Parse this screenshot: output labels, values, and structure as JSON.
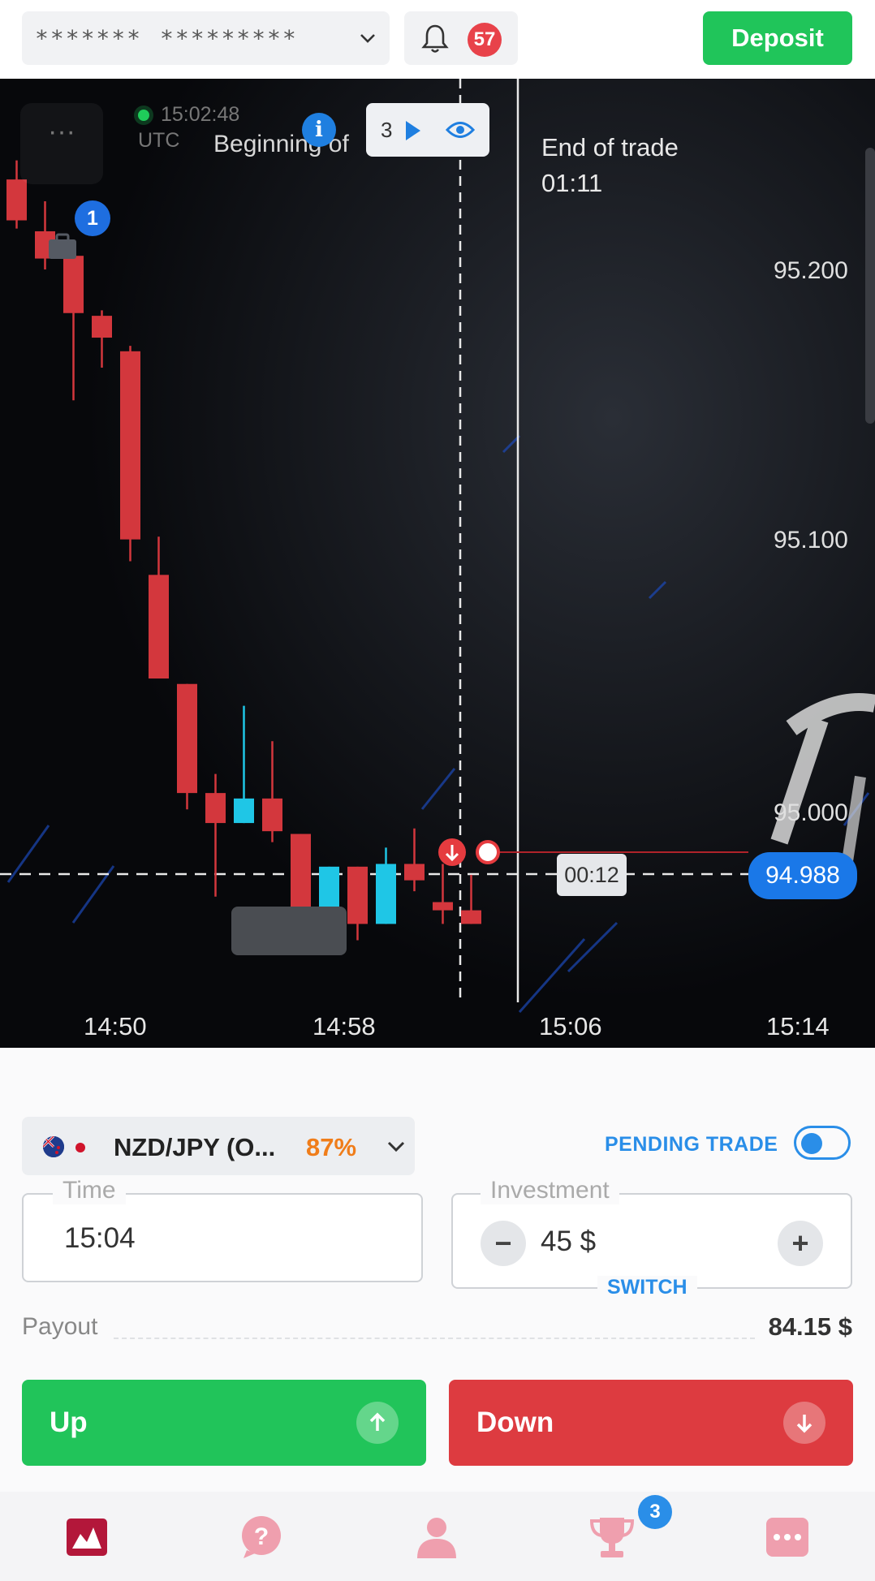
{
  "header": {
    "account_mask_1": "*******",
    "account_mask_2": "*********",
    "notifications_count": "57",
    "deposit_label": "Deposit"
  },
  "chart": {
    "server_time": "15:02:48",
    "timezone": "UTC",
    "beginning_label": "Beginning of",
    "end_label": "End of trade",
    "end_time": "01:11",
    "trades_count": "3",
    "marker_number": "1",
    "timer": "00:12",
    "current_price": "94.988",
    "price_ticks": [
      "95.200",
      "95.100",
      "95.000"
    ],
    "time_ticks": [
      "14:50",
      "14:58",
      "15:06",
      "15:14"
    ],
    "menu_glyph": "···",
    "colors": {
      "bear": "#d3373d",
      "bull": "#1fc6e6",
      "price_badge": "#1a78e8"
    }
  },
  "chart_data": {
    "type": "candlestick",
    "x_ticks": [
      "14:50",
      "14:58",
      "15:06",
      "15:14"
    ],
    "y_ticks": [
      95.2,
      95.1,
      95.0
    ],
    "current_price": 94.988,
    "candles": [
      {
        "o": 95.233,
        "h": 95.24,
        "l": 95.215,
        "c": 95.218
      },
      {
        "o": 95.214,
        "h": 95.225,
        "l": 95.2,
        "c": 95.204
      },
      {
        "o": 95.205,
        "h": 95.21,
        "l": 95.152,
        "c": 95.184
      },
      {
        "o": 95.183,
        "h": 95.185,
        "l": 95.164,
        "c": 95.175
      },
      {
        "o": 95.17,
        "h": 95.172,
        "l": 95.093,
        "c": 95.101
      },
      {
        "o": 95.088,
        "h": 95.102,
        "l": 95.05,
        "c": 95.05
      },
      {
        "o": 95.048,
        "h": 95.048,
        "l": 95.002,
        "c": 95.008
      },
      {
        "o": 95.008,
        "h": 95.015,
        "l": 94.97,
        "c": 94.997
      },
      {
        "o": 94.997,
        "h": 95.04,
        "l": 94.997,
        "c": 95.006
      },
      {
        "o": 95.006,
        "h": 95.027,
        "l": 94.99,
        "c": 94.994
      },
      {
        "o": 94.993,
        "h": 94.993,
        "l": 94.96,
        "c": 94.956
      },
      {
        "o": 94.966,
        "h": 94.981,
        "l": 94.962,
        "c": 94.981
      },
      {
        "o": 94.981,
        "h": 94.981,
        "l": 94.954,
        "c": 94.96
      },
      {
        "o": 94.96,
        "h": 94.988,
        "l": 94.96,
        "c": 94.982
      },
      {
        "o": 94.982,
        "h": 94.995,
        "l": 94.972,
        "c": 94.976
      },
      {
        "o": 94.968,
        "h": 94.982,
        "l": 94.96,
        "c": 94.965
      },
      {
        "o": 94.965,
        "h": 94.978,
        "l": 94.96,
        "c": 94.96
      }
    ]
  },
  "trade": {
    "asset_name": "NZD/JPY (O...",
    "asset_payout_pct": "87%",
    "pending_label": "PENDING TRADE",
    "time_label": "Time",
    "time_value": "15:04",
    "investment_label": "Investment",
    "investment_value": "45 $",
    "switch_label": "SWITCH",
    "payout_label": "Payout",
    "payout_value": "84.15 $",
    "up_label": "Up",
    "down_label": "Down"
  },
  "nav": {
    "trophy_badge": "3",
    "items": [
      "chart-icon",
      "help-icon",
      "profile-icon",
      "trophy-icon",
      "more-icon"
    ]
  }
}
